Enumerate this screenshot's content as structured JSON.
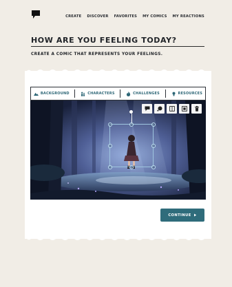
{
  "nav": {
    "logo_icon": "speech-bubble-icon",
    "links": [
      "CREATE",
      "DISCOVER",
      "FAVORITES",
      "MY COMICS",
      "MY REACTIONS"
    ]
  },
  "page": {
    "title": "HOW ARE YOU FEELING TODAY?",
    "subtitle": "CREATE A COMIC THAT REPRESENTS YOUR FEELINGS."
  },
  "editor": {
    "tabs": [
      {
        "label": "BACKGROUND",
        "icon": "mountain-icon"
      },
      {
        "label": "CHARACTERS",
        "icon": "characters-icon"
      },
      {
        "label": "CHALLENGES",
        "icon": "fire-icon"
      },
      {
        "label": "RESOURCES",
        "icon": "lightbulb-icon"
      }
    ],
    "tools": [
      "speech-bubble-icon",
      "thought-bubble-icon",
      "flip-icon",
      "layer-icon",
      "trash-icon"
    ]
  },
  "actions": {
    "continue_label": "CONTINUE",
    "continue_icon": "play-arrow-icon"
  },
  "colors": {
    "accent": "#2f6c7b",
    "tab_text": "#2d6676",
    "page_bg": "#f1ede6"
  }
}
